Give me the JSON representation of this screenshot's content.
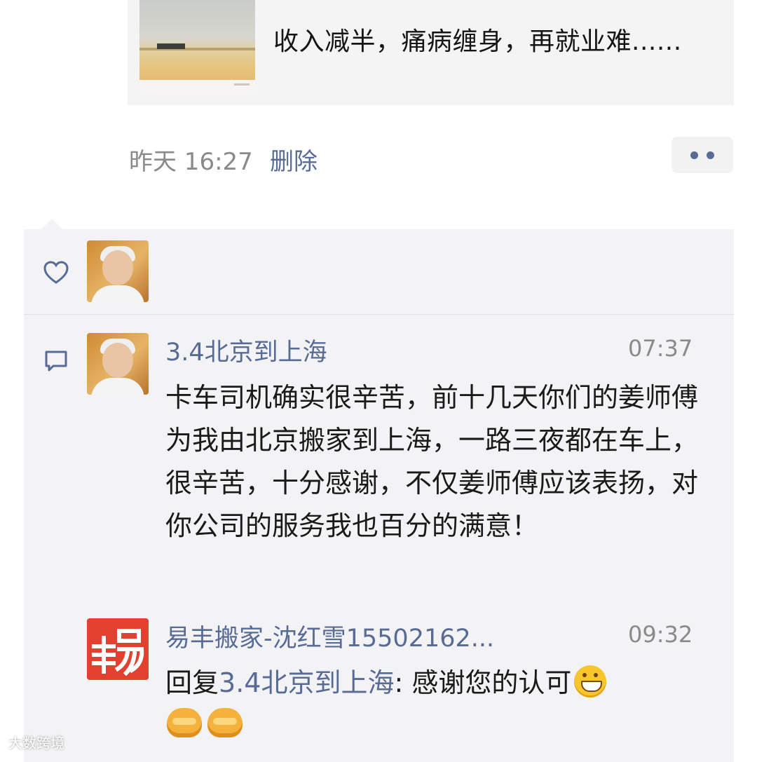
{
  "shared_post": {
    "title": "收入减半，痛病缠身，再就业难......"
  },
  "meta": {
    "time": "昨天 16:27",
    "delete_label": "删除"
  },
  "icons": {
    "more": "more-dots-icon",
    "like": "heart-icon",
    "comment": "comment-icon"
  },
  "comments": [
    {
      "name": "3.4北京到上海",
      "time": "07:37",
      "text": "卡车司机确实很辛苦，前十几天你们的姜师傅为我由北京搬家到上海，一路三夜都在车上，很辛苦，十分感谢，不仅姜师傅应该表扬，对你公司的服务我也百分的满意！"
    },
    {
      "name": "易丰搬家-沈红雪15502162...",
      "time": "09:32",
      "reply_prefix": "回复",
      "reply_to": "3.4北京到上海",
      "reply_text": ": 感谢您的认可"
    }
  ],
  "watermark": "大数跨境",
  "colors": {
    "link": "#576b95",
    "panel_bg": "#f3f3f5",
    "brand_avatar": "#e2412f"
  }
}
